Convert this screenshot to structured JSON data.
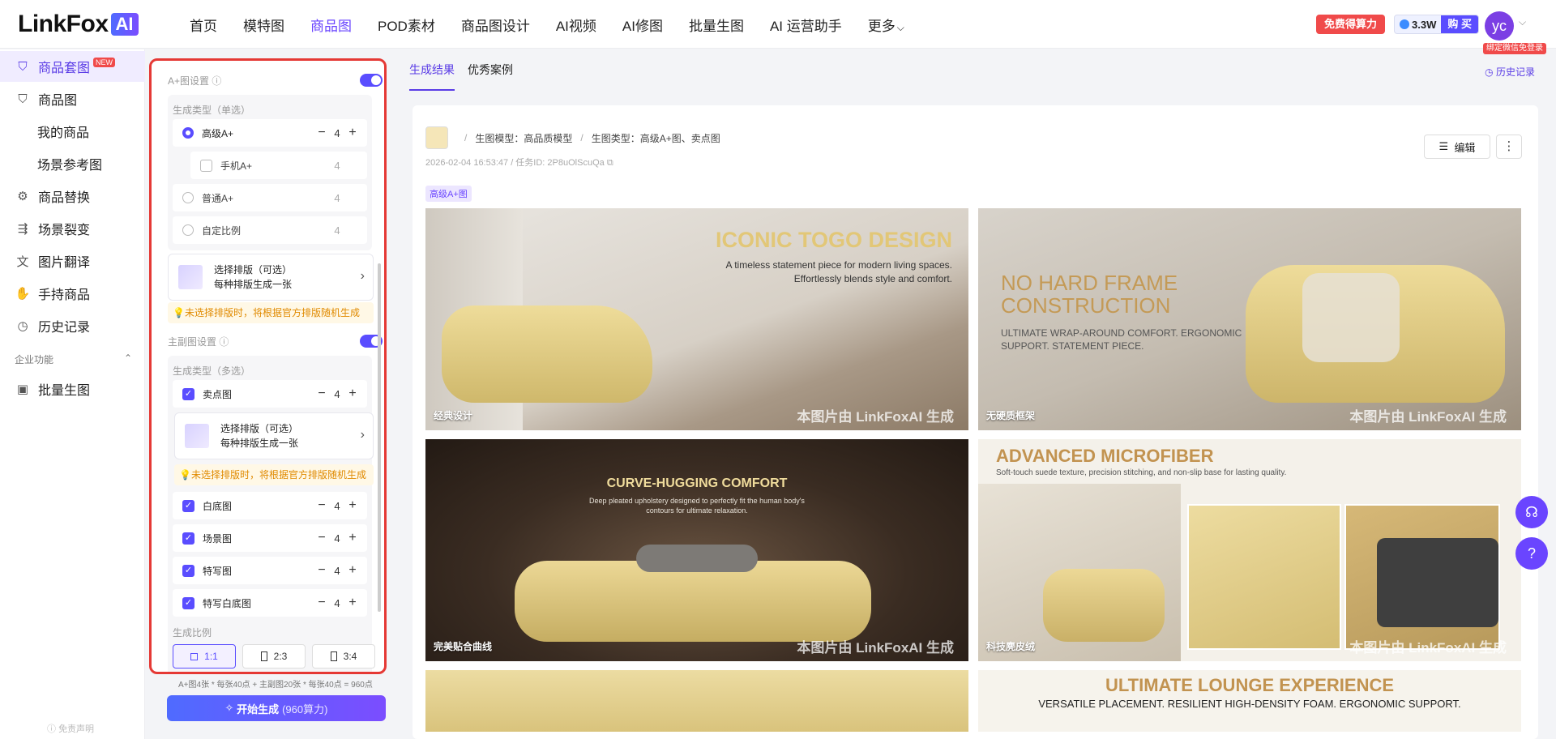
{
  "header": {
    "logo_text": "LinkFox",
    "logo_ai": "AI",
    "nav": [
      {
        "label": "首页"
      },
      {
        "label": "模特图"
      },
      {
        "label": "商品图"
      },
      {
        "label": "POD素材"
      },
      {
        "label": "商品图设计"
      },
      {
        "label": "AI视频"
      },
      {
        "label": "AI修图"
      },
      {
        "label": "批量生图"
      },
      {
        "label": "AI 运营助手"
      },
      {
        "label": "更多"
      }
    ],
    "active_nav": "商品图",
    "free_points": "免费得算力",
    "points": "3.3W",
    "buy": "购 买",
    "avatar": "yc",
    "wechat_tag": "绑定微信免登录"
  },
  "sidebar": {
    "items": [
      {
        "label": "商品套图",
        "badge": "NEW",
        "icon": "bag-icon"
      },
      {
        "label": "商品图",
        "icon": "bag-icon"
      },
      {
        "label": "我的商品"
      },
      {
        "label": "场景参考图"
      },
      {
        "label": "商品替换",
        "icon": "swap-icon"
      },
      {
        "label": "场景裂变",
        "icon": "split-icon"
      },
      {
        "label": "图片翻译",
        "icon": "translate-icon"
      },
      {
        "label": "手持商品",
        "icon": "hand-icon"
      },
      {
        "label": "历史记录",
        "icon": "clock-icon"
      },
      {
        "label": "批量生图",
        "icon": "image-icon"
      }
    ],
    "section": "企业功能",
    "disclaimer": "免责声明"
  },
  "panel": {
    "aplus_title": "A+图设置",
    "type_single": "生成类型（单选）",
    "aplus_options": [
      {
        "label": "高级A+",
        "count": "4",
        "selected": true
      },
      {
        "label": "手机A+",
        "count": "4"
      },
      {
        "label": "普通A+",
        "count": "4"
      },
      {
        "label": "自定比例",
        "count": "4"
      }
    ],
    "layout_title": "选择排版（可选）",
    "layout_sub": "每种排版生成一张",
    "tip": "💡未选择排版时，将根据官方排版随机生成",
    "main_title": "主副图设置",
    "type_multi": "生成类型（多选）",
    "main_options": [
      {
        "label": "卖点图",
        "count": "4"
      },
      {
        "label": "白底图",
        "count": "4"
      },
      {
        "label": "场景图",
        "count": "4"
      },
      {
        "label": "特写图",
        "count": "4"
      },
      {
        "label": "特写白底图",
        "count": "4"
      }
    ],
    "ratio_title": "生成比例",
    "ratios": [
      "1:1",
      "2:3",
      "3:4"
    ],
    "summary": "A+图4张 * 每张40点 + 主副图20张 * 每张40点 = 960点",
    "start": "开始生成",
    "start_sub": "(960算力)"
  },
  "main": {
    "tabs": [
      "生成结果",
      "优秀案例"
    ],
    "history": "历史记录",
    "model": "生图模型：高品质模型",
    "gen_type": "生图类型：高级A+图、卖点图",
    "meta": "2026-02-04 16:53:47 / 任务ID: 2P8uOlScuQa",
    "edit": "编辑",
    "tag": "高级A+图",
    "watermark": "本图片由 LinkFoxAI 生成",
    "cards": [
      {
        "caption": "经典设计",
        "headline": "ICONIC TOGO DESIGN",
        "body": "A timeless statement piece for modern living spaces. Effortlessly blends style and comfort."
      },
      {
        "caption": "无硬质框架",
        "headline": "NO HARD FRAME CONSTRUCTION",
        "body": "ULTIMATE WRAP-AROUND COMFORT. ERGONOMIC SUPPORT. STATEMENT PIECE."
      },
      {
        "caption": "完美贴合曲线",
        "headline": "CURVE-HUGGING COMFORT",
        "body": "Deep pleated upholstery designed to perfectly fit the human body's contours for ultimate relaxation."
      },
      {
        "caption": "科技麂皮绒",
        "headline": "ADVANCED MICROFIBER",
        "body": "Soft-touch suede texture, precision stitching, and non-slip base for lasting quality."
      },
      {
        "caption": "",
        "headline": "",
        "body": ""
      },
      {
        "caption": "",
        "headline": "ULTIMATE LOUNGE EXPERIENCE",
        "body": "VERSATILE PLACEMENT. RESILIENT HIGH-DENSITY FOAM. ERGONOMIC SUPPORT."
      }
    ]
  },
  "colors": {
    "accent": "#5a4dff",
    "highlight": "#e53935"
  }
}
